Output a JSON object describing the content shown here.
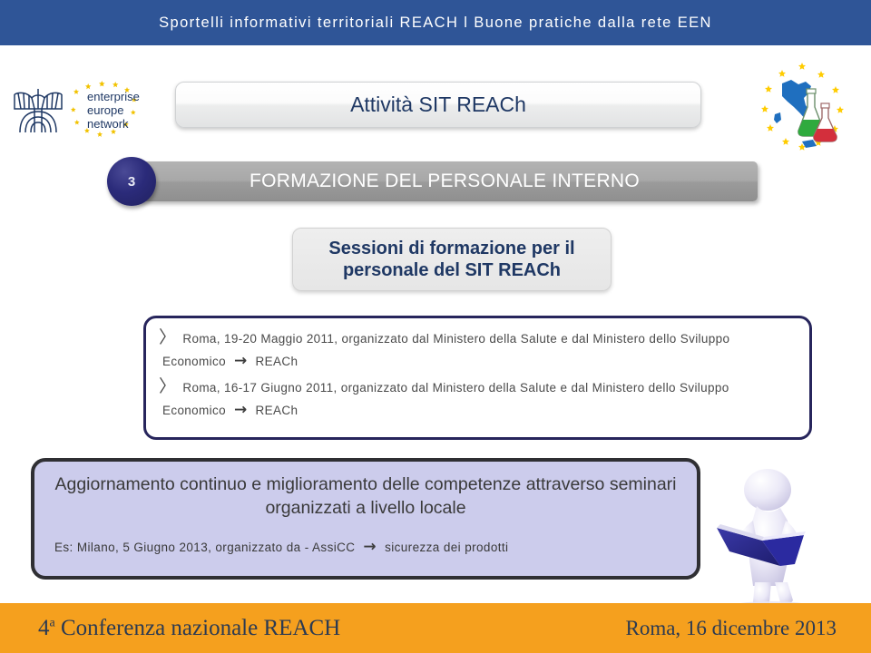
{
  "header": {
    "title": "Sportelli informativi territoriali REACH l Buone pratiche dalla rete EEN",
    "bg_color": "#2f5597",
    "text_color": "#ffffff"
  },
  "logos": {
    "een": {
      "name": "enterprise-europe-network-logo",
      "line1": "enterprise",
      "line2": "europe",
      "line3": "network",
      "text_color": "#1f3864",
      "star_color": "#f2c200"
    },
    "italy_reach": {
      "name": "italy-reach-logo",
      "map_color": "#1f6fbf",
      "star_color": "#ffcc00",
      "flask_green": "#2faa3e",
      "flask_red": "#d32f3c"
    }
  },
  "activity_pill": {
    "label": "Attività SIT REACh",
    "text_color": "#1f3864"
  },
  "step": {
    "number": "3",
    "badge_color": "#2b2b7a",
    "bar_label": "FORMAZIONE DEL PERSONALE INTERNO",
    "bar_color": "#a0a0a0",
    "bar_text_color": "#ffffff"
  },
  "sessions_box": {
    "label": "Sessioni di formazione per il personale del SIT REACh",
    "text_color": "#1f3864"
  },
  "bullets": {
    "border_color": "#27255c",
    "marker": "〉",
    "arrow": "→",
    "items": [
      {
        "line1": "Roma, 19-20 Maggio 2011, organizzato dal Ministero della Salute e dal Ministero dello Sviluppo",
        "line2_before": "Economico",
        "line2_after": "REACh"
      },
      {
        "line1": "Roma, 16-17 Giugno 2011, organizzato dal Ministero della Salute e dal Ministero dello Sviluppo",
        "line2_before": "Economico",
        "line2_after": "REACh"
      }
    ]
  },
  "update_box": {
    "bg_color": "#ccccec",
    "border_color": "#2f2f33",
    "heading": "Aggiornamento continuo e miglioramento delle competenze attraverso seminari organizzati a livello locale",
    "example_before": "Es: Milano, 5 Giugno 2013, organizzato da - AssiCC",
    "arrow": "→",
    "example_after": "sicurezza dei prodotti"
  },
  "reader_figure": {
    "name": "person-reading-book-illustration",
    "body_color": "#e4e2f2",
    "book_color": "#2a2a8c"
  },
  "footer": {
    "bg_color": "#f5a01e",
    "text_color": "#2b3a52",
    "conference_number": "4",
    "conference_ordinal": "a",
    "conference_title": " Conferenza nazionale REACH",
    "date": "Roma, 16 dicembre 2013"
  }
}
